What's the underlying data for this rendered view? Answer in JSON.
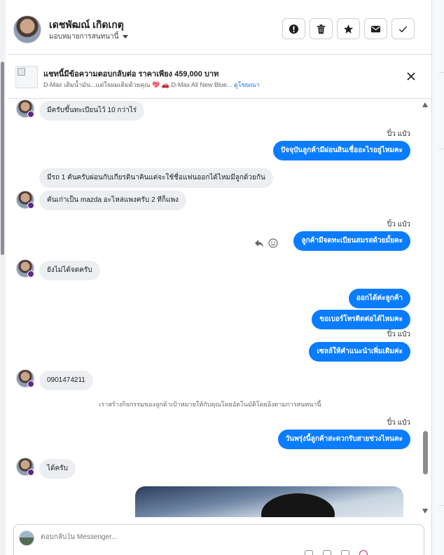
{
  "header": {
    "contact_name": "เดชพัฒณ์ เกิดเกตุ",
    "assign_label": "มอบหมายการสนทนานี้",
    "actions": [
      {
        "name": "mark-spam-button",
        "icon": "exclamation-circle-icon"
      },
      {
        "name": "delete-button",
        "icon": "trash-icon"
      },
      {
        "name": "star-button",
        "icon": "star-icon"
      },
      {
        "name": "mark-unread-button",
        "icon": "envelope-icon"
      },
      {
        "name": "mark-done-button",
        "icon": "check-icon"
      }
    ]
  },
  "banner": {
    "title": "แชทนี้มีข้อความตอบกลับต่อ ราคาเพียง 459,000 บาท",
    "subtitle": "D-Max เติมน้ำมัน...แต่ใจผมเติมด้วยคุณ 💖 🚗 D-Max All New Blue...",
    "link": "ดูโฆษณา"
  },
  "conversation": {
    "messages": [
      {
        "dir": "in",
        "text": "มีครับขึ้นทะเบียนไว้ 10 กว่าไร่"
      },
      {
        "dir": "out",
        "sender": "ปิ๋ว แป๋ว",
        "text": "ปัจจุบันลูกค้ามีผ่อนสินเชื่ออะไรอยู่ไหมคะ"
      },
      {
        "dir": "in",
        "text": "มีรถ 1 คันครับผ่อนกับเกียรตินาคินแต่จะใช้ชื่อแฟนออกได้ไหมมีลูกด้วยกัน"
      },
      {
        "dir": "in",
        "text": "คันเก่าเป็น mazda อะไหล่แพงครับ 2 ทีก็แพง"
      },
      {
        "dir": "out",
        "sender": "ปิ๋ว แป๋ว",
        "text": "ลูกค้ามีจดทะเบียนสมรสด้วยมั้ยคะ"
      },
      {
        "dir": "in",
        "text": "ยังไม่ได้จดครับ"
      },
      {
        "dir": "out",
        "text": "ออกได้ค่ะลูกค้า"
      },
      {
        "dir": "out",
        "text": "ขอเบอร์โทรติดต่อได้ไหมคะ"
      },
      {
        "dir": "out",
        "sender": "ปิ๋ว แป๋ว",
        "text": "เซลล์ให้คำแนะนำเพิ่มเติมค่ะ"
      },
      {
        "dir": "in",
        "text": "0901474211"
      },
      {
        "dir": "out",
        "sender": "ปิ๋ว แป๋ว",
        "text": "วันพรุ่งนี้ลูกค้าสะดวกรับสายช่วงไหนคะ"
      },
      {
        "dir": "in",
        "text": "ได้ครับ"
      }
    ],
    "system_note": "เราสร้างกิจกรรมของลูกค้าเป้าหมายให้กับคุณโดยอัตโนมัติโดยอิงตามการสนทนานี้"
  },
  "composer": {
    "placeholder": "ตอบกลับใน Messenger..."
  }
}
